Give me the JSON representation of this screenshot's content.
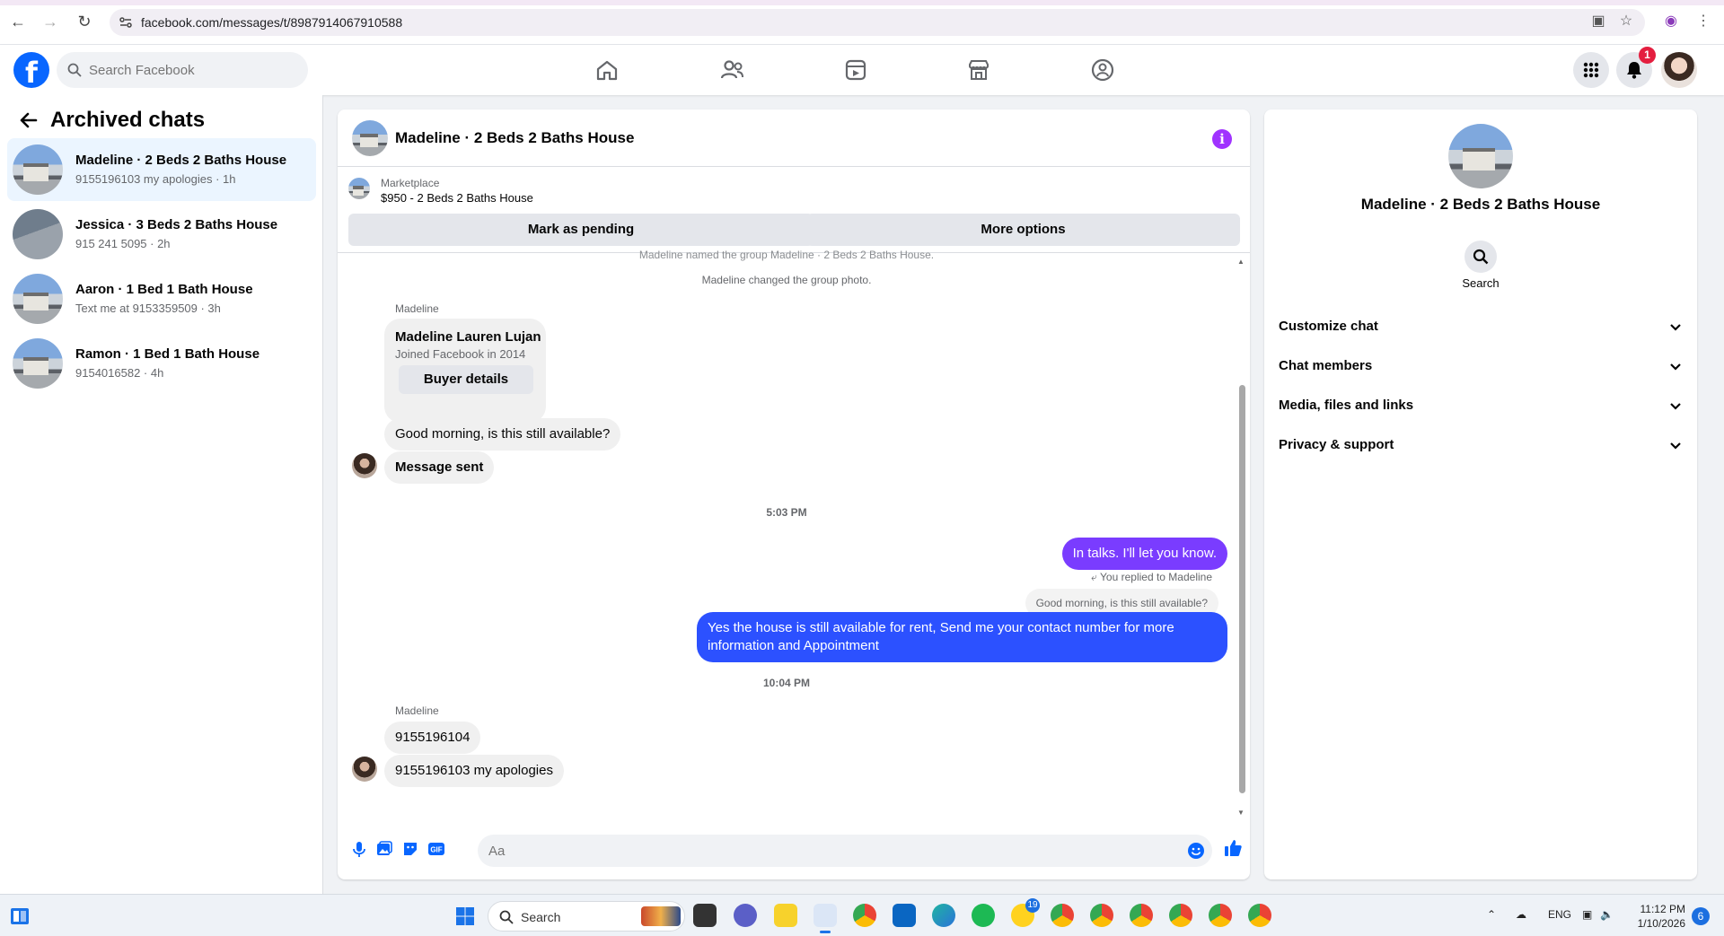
{
  "browser": {
    "url": "facebook.com/messages/t/8987914067910588"
  },
  "header": {
    "search_placeholder": "Search Facebook",
    "notification_count": "1",
    "nav_icons": [
      "home-icon",
      "friends-icon",
      "video-icon",
      "marketplace-icon",
      "groups-icon"
    ]
  },
  "sidebar": {
    "title": "Archived chats",
    "chats": [
      {
        "name": "Madeline · 2 Beds 2 Baths House",
        "preview": "9155196103 my apologies · 1h"
      },
      {
        "name": "Jessica · 3 Beds 2 Baths House",
        "preview": "915 241 5095 · 2h"
      },
      {
        "name": "Aaron · 1 Bed 1 Bath House",
        "preview": "Text me at 9153359509 · 3h"
      },
      {
        "name": "Ramon · 1 Bed 1 Bath House",
        "preview": "9154016582 · 4h"
      }
    ]
  },
  "chat": {
    "title": "Madeline · 2 Beds 2 Baths House",
    "marketplace_label": "Marketplace",
    "listing": "$950 - 2 Beds 2 Baths House",
    "mark_pending": "Mark as pending",
    "more_options": "More options",
    "system_top": "Madeline named the group Madeline · 2 Beds 2 Baths House.",
    "system_photo": "Madeline changed the group photo.",
    "sender_1": "Madeline",
    "card_name": "Madeline Lauren Lujan",
    "card_sub": "Joined Facebook in 2014",
    "card_button": "Buyer details",
    "msg_1": "Good morning, is this still available?",
    "msg_2": "Message sent",
    "time_1": "5:03 PM",
    "my_msg_1": "In talks. I'll let you know.",
    "reply_label": "You replied to Madeline",
    "quoted": "Good morning, is this still available?",
    "my_msg_2": "Yes the house is still available for rent, Send me your contact number for more information and Appointment",
    "time_2": "10:04 PM",
    "sender_2": "Madeline",
    "msg_3": "9155196104",
    "msg_4": "9155196103 my apologies",
    "composer_placeholder": "Aa"
  },
  "details": {
    "title": "Madeline · 2 Beds 2 Baths House",
    "search_label": "Search",
    "sections": [
      "Customize chat",
      "Chat members",
      "Media, files and links",
      "Privacy & support"
    ]
  },
  "taskbar": {
    "search_label": "Search",
    "badge_19": "19",
    "lang": "ENG",
    "time": "11:12 PM",
    "date": "1/10/2026",
    "notif": "6"
  },
  "colors": {
    "fb_blue": "#0866ff",
    "my_bubble_purple": "#7a3cff",
    "my_bubble_blue": "#2c51ff",
    "info_purple": "#a033ff",
    "badge_red": "#e41e3f"
  }
}
